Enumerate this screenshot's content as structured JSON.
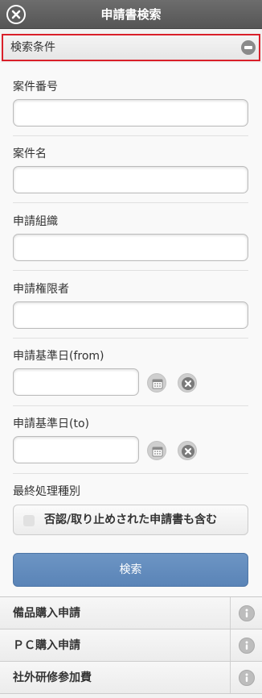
{
  "header": {
    "title": "申請書検索"
  },
  "search_section": {
    "title": "検索条件"
  },
  "fields": {
    "case_number": {
      "label": "案件番号",
      "value": ""
    },
    "case_name": {
      "label": "案件名",
      "value": ""
    },
    "applicant_org": {
      "label": "申請組織",
      "value": ""
    },
    "authorized_applicant": {
      "label": "申請権限者",
      "value": ""
    },
    "base_date_from": {
      "label": "申請基準日(from)",
      "value": ""
    },
    "base_date_to": {
      "label": "申請基準日(to)",
      "value": ""
    },
    "final_process_type": {
      "label": "最終処理種別",
      "checkbox_label": "否認/取り止めされた申請書も含む",
      "checked": false
    }
  },
  "search_button": {
    "label": "検索"
  },
  "results": [
    {
      "label": "備品購入申請"
    },
    {
      "label": "ＰＣ購入申請"
    },
    {
      "label": "社外研修参加費"
    }
  ],
  "colors": {
    "header_bg": "#5f5f5f",
    "highlight_border": "#d9202a",
    "primary_button": "#6189bb"
  }
}
